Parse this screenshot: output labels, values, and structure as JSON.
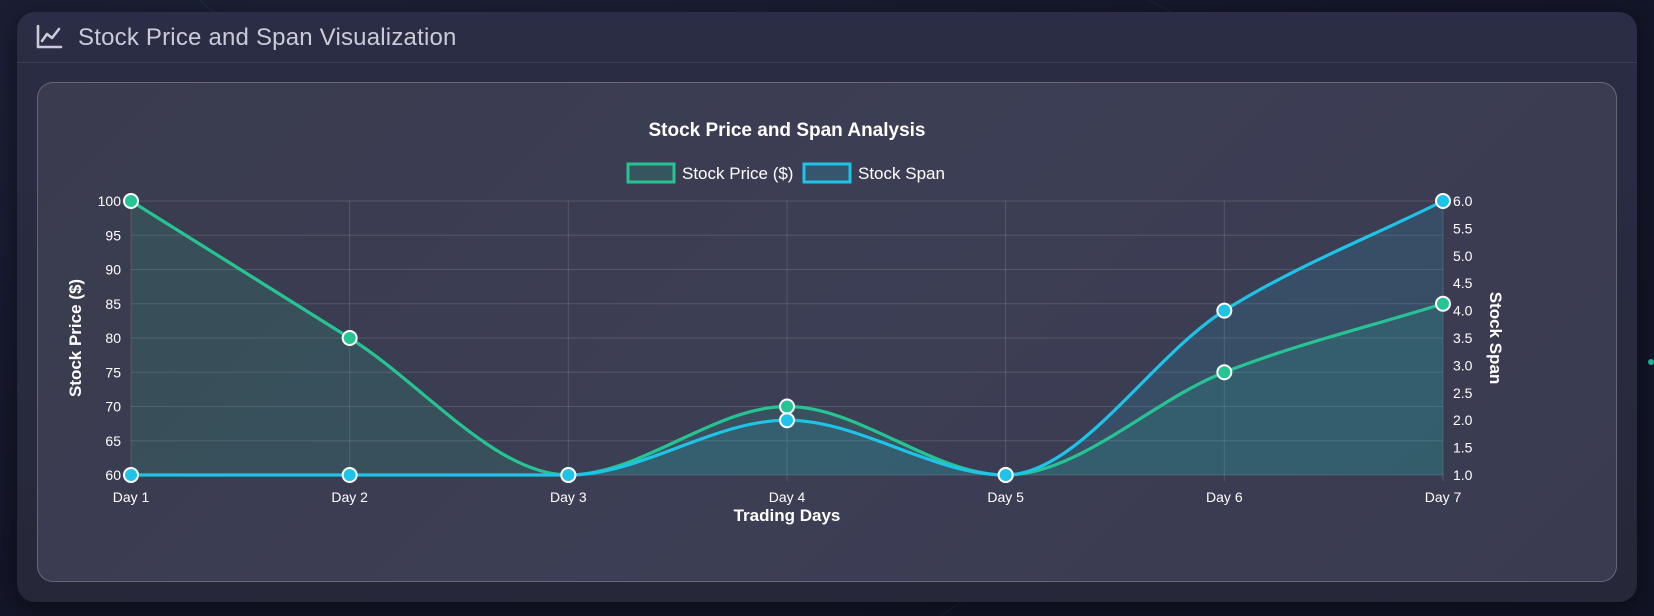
{
  "header": {
    "title": "Stock Price and Span Visualization",
    "icon": "line-chart-icon"
  },
  "colors": {
    "price": "#27c493",
    "span": "#1ec3e8"
  },
  "chart_data": {
    "type": "line",
    "title": "Stock Price and Span Analysis",
    "xlabel": "Trading Days",
    "ylabel_left": "Stock Price ($)",
    "ylabel_right": "Stock Span",
    "categories": [
      "Day 1",
      "Day 2",
      "Day 3",
      "Day 4",
      "Day 5",
      "Day 6",
      "Day 7"
    ],
    "series": [
      {
        "name": "Stock Price ($)",
        "axis": "left",
        "values": [
          100,
          80,
          60,
          70,
          60,
          75,
          85
        ],
        "fill": true
      },
      {
        "name": "Stock Span",
        "axis": "right",
        "values": [
          1,
          1,
          1,
          2,
          1,
          4,
          6
        ],
        "fill": true
      }
    ],
    "ylim_left": [
      60,
      100
    ],
    "yticks_left": [
      "100",
      "95",
      "90",
      "85",
      "80",
      "75",
      "70",
      "65",
      "60"
    ],
    "ylim_right": [
      1,
      6
    ],
    "yticks_right": [
      "6.0",
      "5.5",
      "5.0",
      "4.5",
      "4.0",
      "3.5",
      "3.0",
      "2.5",
      "2.0",
      "1.5",
      "1.0"
    ],
    "legend_position": "top",
    "grid": true
  }
}
